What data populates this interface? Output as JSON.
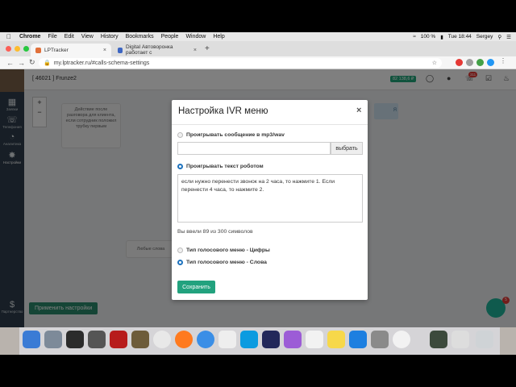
{
  "menubar": {
    "app": "Chrome",
    "items": [
      "File",
      "Edit",
      "View",
      "History",
      "Bookmarks",
      "People",
      "Window",
      "Help"
    ],
    "battery": "100 %",
    "clock": "Tue 18:44",
    "user": "Sergey"
  },
  "tabs": [
    {
      "title": "LPTracker"
    },
    {
      "title": "Digital Автоворонка работает с"
    }
  ],
  "address": {
    "url": "my.lptracker.ru/#calls-schema-settings"
  },
  "app": {
    "account": "[ 46021 ] Frunze2",
    "balance": "82 138,6 ₽",
    "notif_count": "311",
    "sidebar": [
      {
        "label": "Заявки"
      },
      {
        "label": "Телефония"
      },
      {
        "label": "Аналитика"
      },
      {
        "label": "Настройки"
      },
      {
        "label": "Партнерство"
      }
    ],
    "canvas": {
      "node_top": "Действие после разговора для клиента, если сотрудник положил трубку первым",
      "node_left_partial": "Любые слова",
      "node_right_partial": "Я",
      "apply_label": "Применить настройки",
      "chat_badge": "5"
    }
  },
  "modal": {
    "title": "Настройка IVR меню",
    "opt_mp3": "Проигрывать сообщение в mp3/wav",
    "choose": "выбрать",
    "opt_robot": "Проигрывать текст роботом",
    "robot_text": "если нужно перенести звонок на 2 часа, то нажмите 1. Если перенести 4 часа, то нажмите 2.",
    "counter": "Вы ввели 89 из 300 символов",
    "opt_digits": "Тип голосового меню - Цифры",
    "opt_words": "Тип голосового меню - Слова",
    "submit": "Сохранить"
  },
  "colors": {
    "accent": "#22a27e",
    "sidebar": "#2f3d4c",
    "radio_on": "#1e73be"
  }
}
